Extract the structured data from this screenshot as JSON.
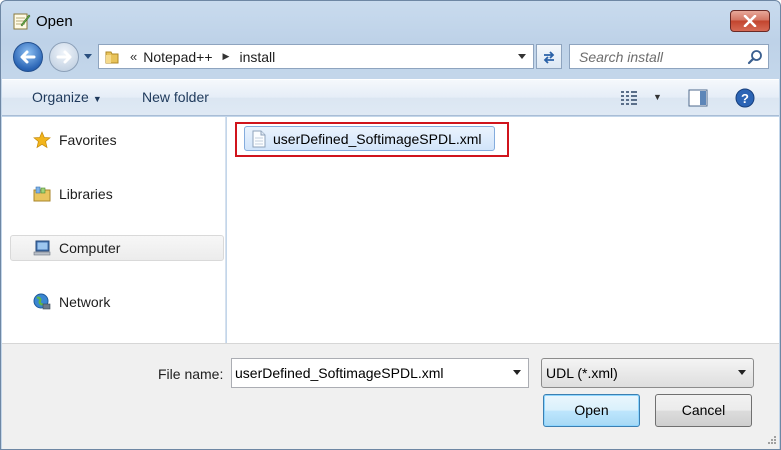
{
  "window": {
    "title": "Open",
    "icon": "notepad-app-icon"
  },
  "nav": {
    "address": {
      "prefix": "«",
      "crumbs": [
        "Notepad++",
        "install"
      ]
    },
    "search": {
      "placeholder": "Search install"
    }
  },
  "commands": {
    "organize": "Organize",
    "new_folder": "New folder"
  },
  "sidebar": {
    "items": [
      {
        "label": "Favorites",
        "icon": "star-icon",
        "selected": false
      },
      {
        "label": "Libraries",
        "icon": "libraries-icon",
        "selected": false
      },
      {
        "label": "Computer",
        "icon": "computer-icon",
        "selected": true
      },
      {
        "label": "Network",
        "icon": "network-icon",
        "selected": false
      }
    ]
  },
  "files": [
    {
      "name": "userDefined_SoftimageSPDL.xml",
      "icon": "xml-file-icon",
      "selected": true
    }
  ],
  "bottom": {
    "file_name_label": "File name:",
    "file_name_value": "userDefined_SoftimageSPDL.xml",
    "file_type": "UDL (*.xml)",
    "open_label": "Open",
    "cancel_label": "Cancel"
  },
  "colors": {
    "highlight": "#d0141c",
    "selection": "#d1e4fa",
    "accent": "#1e395b"
  }
}
